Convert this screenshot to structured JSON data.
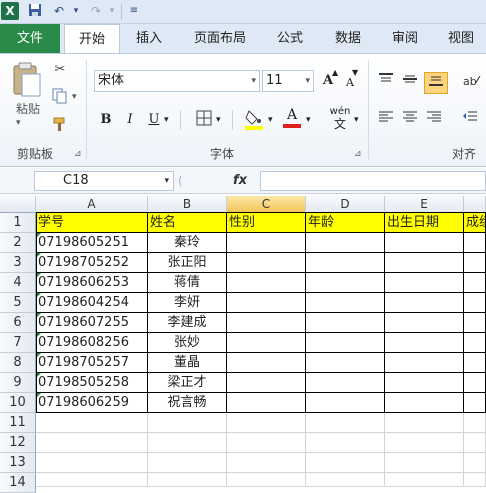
{
  "qat": {
    "excel_logo": "X",
    "save_icon": "floppy-icon",
    "undo_icon": "undo-icon",
    "redo_icon": "redo-icon"
  },
  "tabs": [
    "文件",
    "开始",
    "插入",
    "页面布局",
    "公式",
    "数据",
    "审阅",
    "视图"
  ],
  "ribbon": {
    "paste_label": "粘贴",
    "clipboard_label": "剪贴板",
    "font_label": "字体",
    "align_label": "对齐",
    "font_name": "宋体",
    "font_size": "11",
    "bold": "B",
    "italic": "I",
    "underline": "U",
    "grow_font": "A",
    "shrink_font": "A",
    "font_color_glyph": "A",
    "wen_glyph": "wén"
  },
  "formula_bar": {
    "name_box": "C18",
    "fx": "fx",
    "formula": ""
  },
  "columns": [
    "A",
    "B",
    "C",
    "D",
    "E"
  ],
  "selected_column": "C",
  "rows": [
    "1",
    "2",
    "3",
    "4",
    "5",
    "6",
    "7",
    "8",
    "9",
    "10",
    "11",
    "12",
    "13",
    "14"
  ],
  "table": {
    "headers": [
      "学号",
      "姓名",
      "性别",
      "年龄",
      "出生日期",
      "成绩"
    ],
    "data": [
      [
        "07198605251",
        "秦玲"
      ],
      [
        "07198705252",
        "张正阳"
      ],
      [
        "07198606253",
        "蒋倩"
      ],
      [
        "07198604254",
        "李妍"
      ],
      [
        "07198607255",
        "李建成"
      ],
      [
        "07198608256",
        "张妙"
      ],
      [
        "07198705257",
        "董晶"
      ],
      [
        "07198505258",
        "梁正才"
      ],
      [
        "07198606259",
        "祝言畅"
      ]
    ]
  },
  "colors": {
    "file_tab": "#2a8a4a",
    "header_fill": "#ffff00",
    "selected_col": "#f4c65b",
    "number_marker": "#1e8a3a"
  }
}
